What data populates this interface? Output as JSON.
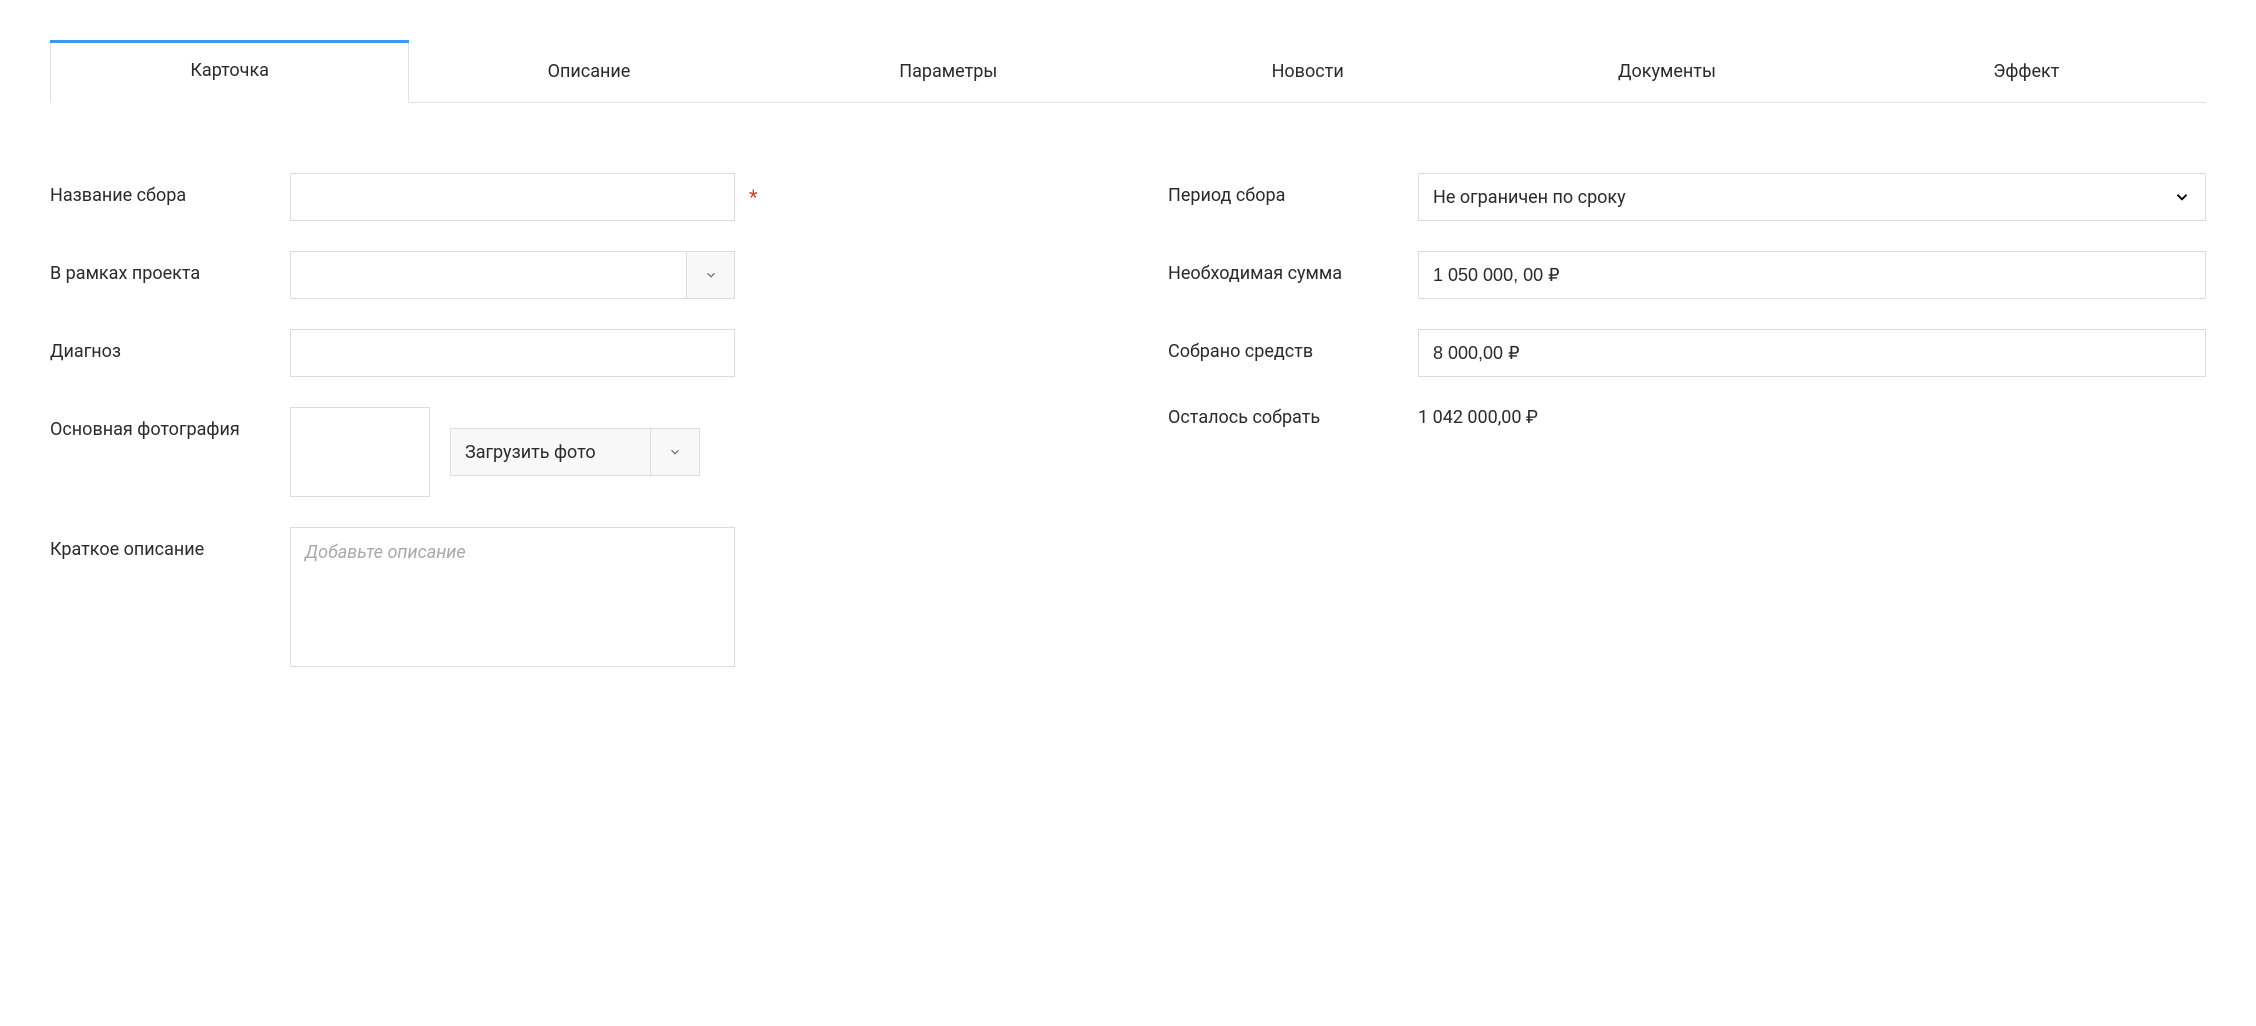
{
  "tabs": {
    "card": "Карточка",
    "description": "Описание",
    "params": "Параметры",
    "news": "Новости",
    "docs": "Документы",
    "effect": "Эффект"
  },
  "left": {
    "name_label": "Название сбора",
    "name_value": "",
    "project_label": "В рамках проекта",
    "project_value": "",
    "diagnosis_label": "Диагноз",
    "diagnosis_value": "",
    "photo_label": "Основная фотография",
    "upload_label": "Загрузить фото",
    "short_desc_label": "Краткое описание",
    "short_desc_placeholder": "Добавьте описание",
    "short_desc_value": ""
  },
  "right": {
    "period_label": "Период сбора",
    "period_value": "Не ограничен по сроку",
    "goal_label": "Необходимая сумма",
    "goal_value": "1 050 000, 00 ₽",
    "collected_label": "Собрано средств",
    "collected_value": "8 000,00 ₽",
    "remaining_label": "Осталось собрать",
    "remaining_value": "1 042 000,00 ₽"
  }
}
